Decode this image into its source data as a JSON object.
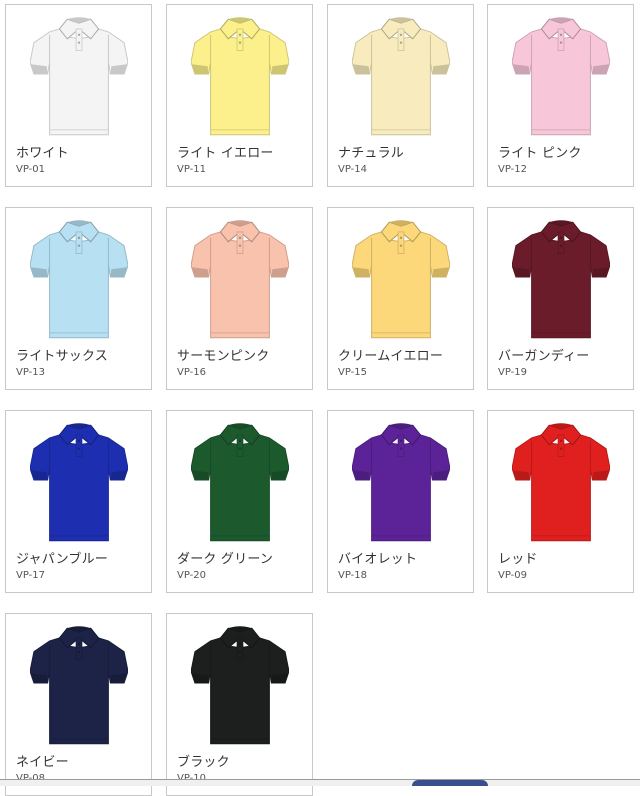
{
  "products": [
    {
      "name": "ホワイト",
      "code": "VP-01",
      "color": "#f4f4f4"
    },
    {
      "name": "ライト イエロー",
      "code": "VP-11",
      "color": "#fbf08b"
    },
    {
      "name": "ナチュラル",
      "code": "VP-14",
      "color": "#f8ecbe"
    },
    {
      "name": "ライト ピンク",
      "code": "VP-12",
      "color": "#f7c7d9"
    },
    {
      "name": "ライトサックス",
      "code": "VP-13",
      "color": "#b7e0f3"
    },
    {
      "name": "サーモンピンク",
      "code": "VP-16",
      "color": "#f9c2ad"
    },
    {
      "name": "クリームイエロー",
      "code": "VP-15",
      "color": "#fcd87a"
    },
    {
      "name": "バーガンディー",
      "code": "VP-19",
      "color": "#6b1c2a"
    },
    {
      "name": "ジャパンブルー",
      "code": "VP-17",
      "color": "#1d2fb0"
    },
    {
      "name": "ダーク グリーン",
      "code": "VP-20",
      "color": "#1c5a2e"
    },
    {
      "name": "バイオレット",
      "code": "VP-18",
      "color": "#5c2399"
    },
    {
      "name": "レッド",
      "code": "VP-09",
      "color": "#e0201f"
    },
    {
      "name": "ネイビー",
      "code": "VP-08",
      "color": "#1c2346"
    },
    {
      "name": "ブラック",
      "code": "VP-10",
      "color": "#1c1f1d"
    }
  ]
}
